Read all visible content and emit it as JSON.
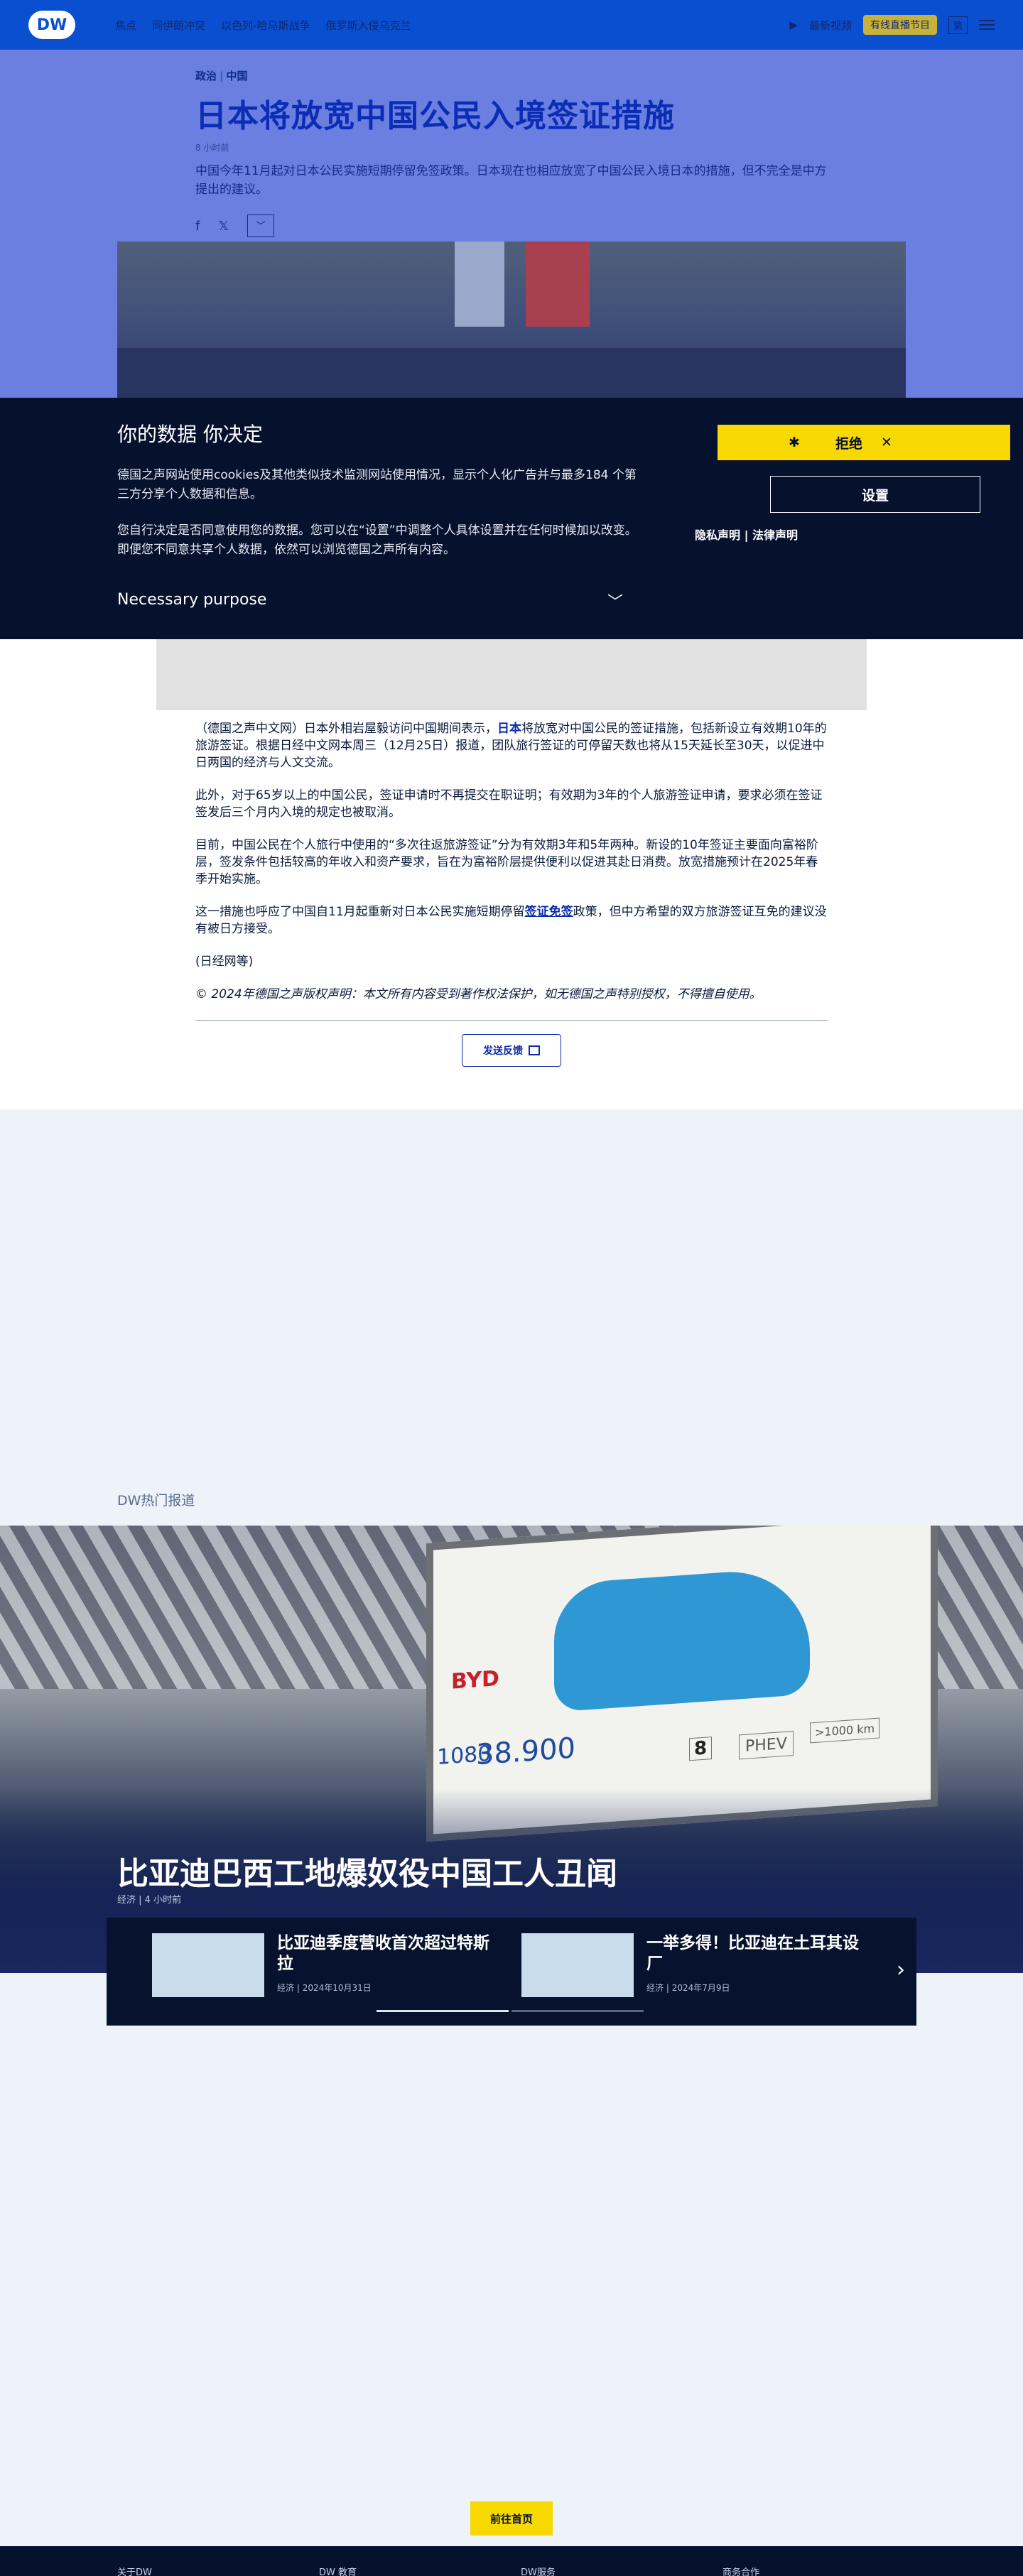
{
  "header": {
    "logo_text": "DW",
    "nav": [
      "焦点",
      "同伊朗冲突",
      "以色列-哈马斯战争",
      "俄罗斯入侵乌克兰"
    ],
    "video_label": "最新视频",
    "live_label": "有线直播节目",
    "lang_label": "繁"
  },
  "article": {
    "category": "政治",
    "region": "中国",
    "title": "日本将放宽中国公民入境签证措施",
    "date": "8 小时前",
    "lead": "中国今年11月起对日本公民实施短期停留免签政策。日本现在也相应放宽了中国公民入境日本的措施，但不完全是中方提出的建议。",
    "share": {
      "facebook": "f",
      "x": "𝕏",
      "more": "﹀"
    },
    "paragraphs": {
      "p1_a": "（德国之声中文网）日本外相岩屋毅访问中国期间表示，",
      "p1_link": "日本",
      "p1_b": "将放宽对中国公民的签证措施，包括新设立有效期10年的旅游签证。根据日经中文网本周三（12月25日）报道，团队旅行签证的可停留天数也将从15天延长至30天，以促进中日两国的经济与人文交流。",
      "p2": "此外，对于65岁以上的中国公民，签证申请时不再提交在职证明；有效期为3年的个人旅游签证申请，要求必须在签证签发后三个月内入境的规定也被取消。",
      "p3": "目前，中国公民在个人旅行中使用的“多次往返旅游签证”分为有效期3年和5年两种。新设的10年签证主要面向富裕阶层，签发条件包括较高的年收入和资产要求，旨在为富裕阶层提供便利以促进其赴日消费。放宽措施预计在2025年春季开始实施。",
      "p4_a": "这一措施也呼应了中国自11月起重新对日本公民实施短期停留",
      "p4_link": "签证免签",
      "p4_b": "政策，但中方希望的双方旅游签证互免的建议没有被日方接受。",
      "p5": "(日经网等)",
      "copyright": "© 2024年德国之声版权声明：本文所有内容受到著作权法保护，如无德国之声特别授权，不得擅自使用。"
    },
    "feedback_label": "发送反馈"
  },
  "cookie": {
    "title": "你的数据 你决定",
    "p1": "德国之声网站使用cookies及其他类似技术监测网站使用情况，显示个人化广告并与最多184 个第三方分享个人数据和信息。",
    "p2": "您自行决定是否同意使用您的数据。您可以在“设置”中调整个人具体设置并在任何时候加以改变。即便您不同意共享个人数据，依然可以浏览德国之声所有内容。",
    "necessary": "Necessary purpose",
    "reject": "拒绝",
    "settings": "设置",
    "privacy": "隐私声明",
    "legal": "法律声明"
  },
  "trending": {
    "label": "DW热门报道",
    "hero_title": "比亚迪巴西工地爆奴役中国工人丑闻",
    "hero_category": "经济",
    "hero_date": "4 小时前",
    "billboard": {
      "brand": "BYD",
      "price_a": "1080",
      "price_b": "38.900",
      "phev": "PHEV",
      "range": ">1000 km",
      "warranty": "8"
    },
    "cards": [
      {
        "title": "比亚迪季度营收首次超过特斯拉",
        "category": "经济",
        "date": "2024年10月31日"
      },
      {
        "title": "一举多得！比亚迪在土耳其设厂",
        "category": "经济",
        "date": "2024年7月9日"
      }
    ],
    "progress_active": 0.5
  },
  "goto_label": "前往首页",
  "footer": [
    "关于DW",
    "DW 教育",
    "DW服务",
    "商务合作"
  ],
  "colors": {
    "brand": "#0a4fd0",
    "accent": "#f7d800",
    "dark": "#06112e"
  }
}
